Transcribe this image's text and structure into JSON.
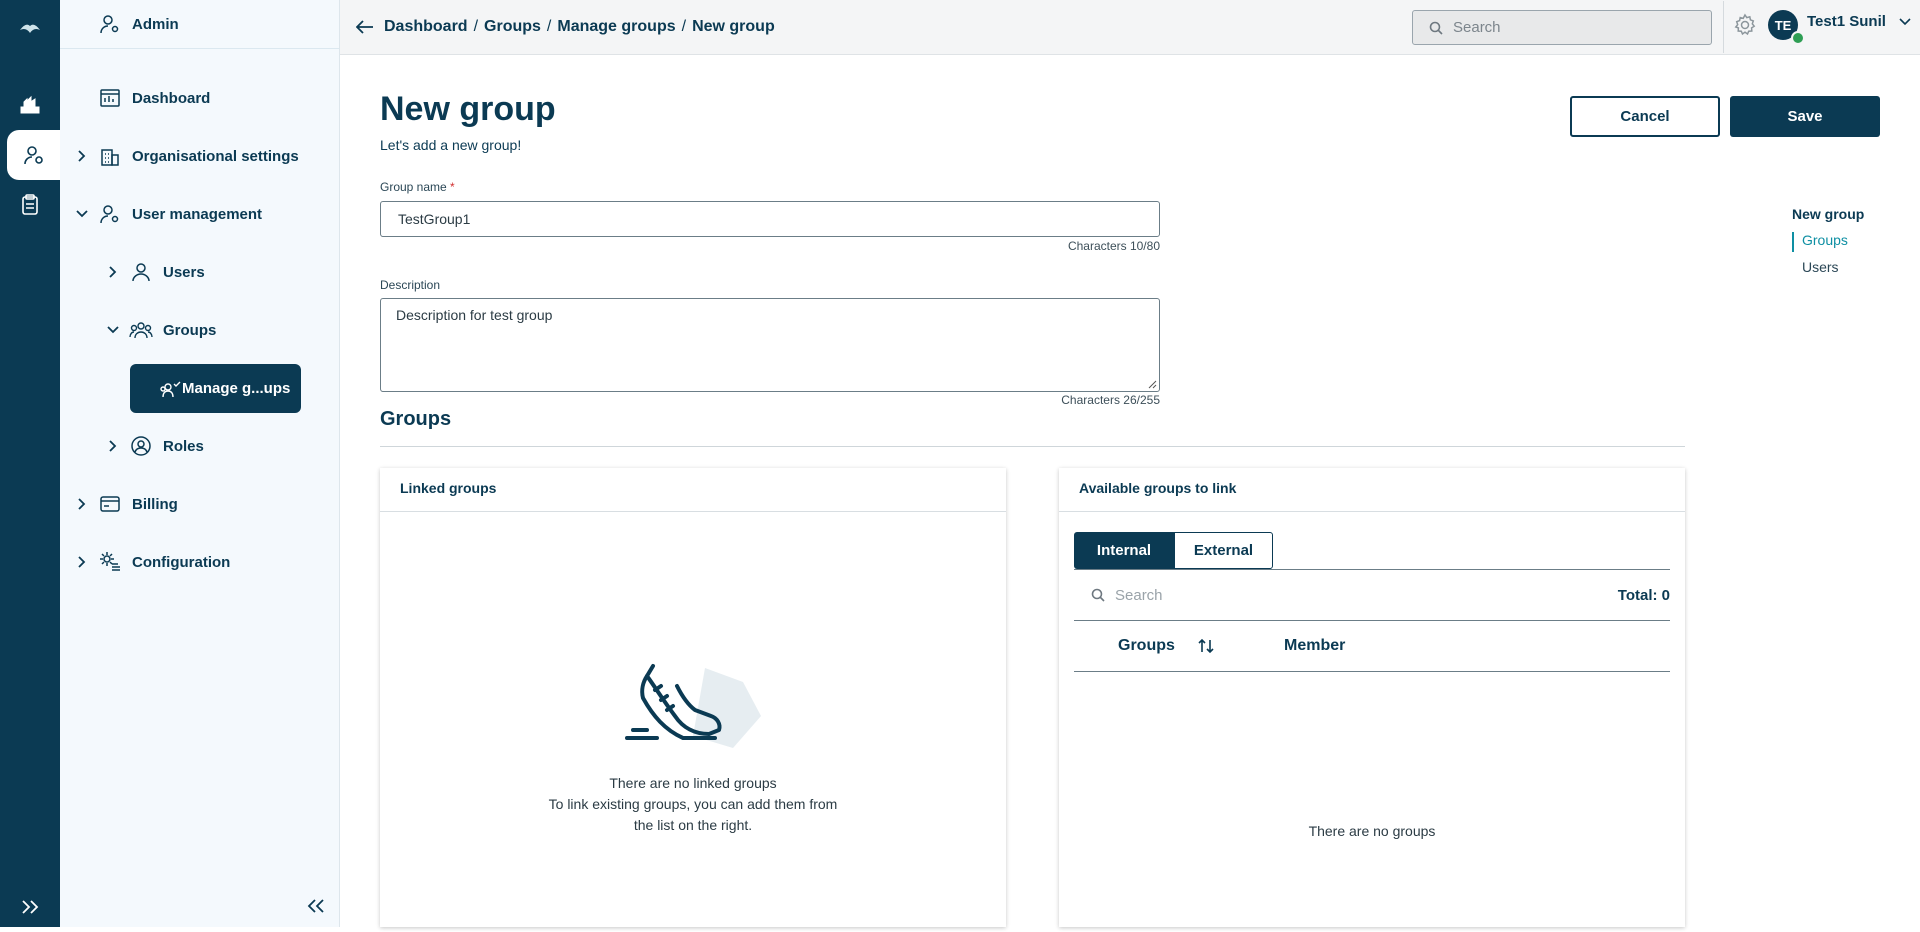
{
  "sidebar": {
    "header": "Admin",
    "items": [
      {
        "label": "Dashboard"
      },
      {
        "label": "Organisational settings"
      },
      {
        "label": "User management"
      },
      {
        "label": "Users"
      },
      {
        "label": "Groups"
      },
      {
        "label": "Manage g...ups"
      },
      {
        "label": "Roles"
      },
      {
        "label": "Billing"
      },
      {
        "label": "Configuration"
      }
    ]
  },
  "breadcrumb": {
    "items": [
      "Dashboard",
      "Groups",
      "Manage groups",
      "New group"
    ],
    "separator": "/"
  },
  "topbar": {
    "search_placeholder": "Search",
    "avatar_initials": "TE",
    "user_name": "Test1 Sunil"
  },
  "page": {
    "title": "New group",
    "subtitle": "Let's add a new group!",
    "cancel_label": "Cancel",
    "save_label": "Save"
  },
  "form": {
    "group_name": {
      "label": "Group name",
      "required_mark": "*",
      "value": "TestGroup1",
      "counter": "Characters 10/80"
    },
    "description": {
      "label": "Description",
      "value": "Description for test group",
      "counter": "Characters 26/255"
    }
  },
  "groups_section": {
    "title": "Groups",
    "linked": {
      "title": "Linked groups",
      "empty_title": "There are no linked groups",
      "empty_line1": "To link existing groups, you can add them from",
      "empty_line2": "the list on the right."
    },
    "available": {
      "title": "Available groups to link",
      "tabs": [
        {
          "label": "Internal",
          "active": true
        },
        {
          "label": "External",
          "active": false
        }
      ],
      "search_placeholder": "Search",
      "total": "Total: 0",
      "columns": [
        "Groups",
        "Member"
      ],
      "empty": "There are no groups"
    }
  },
  "toc": {
    "items": [
      {
        "label": "New group"
      },
      {
        "label": "Groups"
      },
      {
        "label": "Users"
      }
    ]
  },
  "colors": {
    "primary": "#0b3a53",
    "sidebar_bg": "#f4f9fd",
    "accent": "#0e8fa3",
    "status_online": "#2e9e54"
  },
  "icons": [
    "logo-icon",
    "hands-icon",
    "user-gear-icon",
    "clipboard-icon",
    "expand-rail-icon",
    "dashboard-icon",
    "building-icon",
    "user-icon",
    "groups-icon",
    "roles-icon",
    "billing-icon",
    "configuration-icon",
    "collapse-icon",
    "back-arrow-icon",
    "search-icon",
    "gear-icon",
    "chevron-down-icon",
    "sort-icon",
    "sneaker-icon"
  ]
}
